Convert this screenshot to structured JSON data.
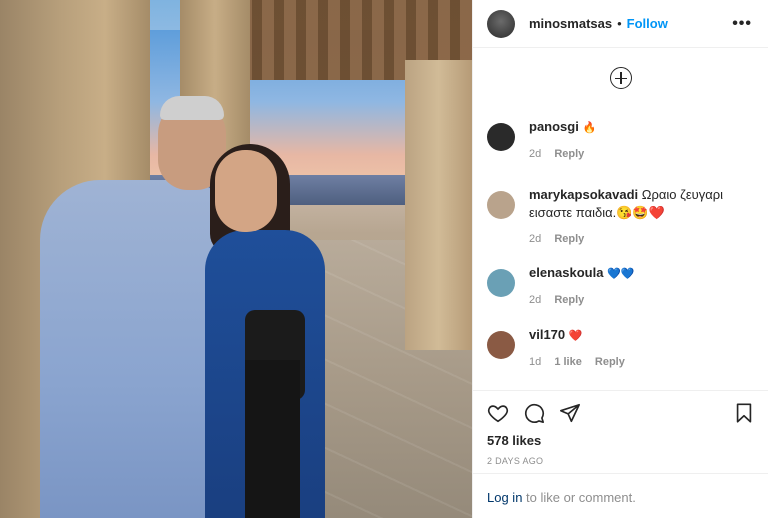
{
  "post": {
    "author": "minosmatsas",
    "separator": "•",
    "follow_label": "Follow",
    "more_label": "•••",
    "likes": "578 likes",
    "timestamp": "2 DAYS AGO"
  },
  "comments": [
    {
      "user": "panosgi",
      "text": "🔥",
      "time": "2d",
      "likes": "",
      "reply": "Reply",
      "avatar_color": "#2a2a2a"
    },
    {
      "user": "marykapsokavadi",
      "text": "Ωραιο ζευγαρι εισαστε παιδια.😘🤩❤️",
      "time": "2d",
      "likes": "",
      "reply": "Reply",
      "avatar_color": "#b9a38c"
    },
    {
      "user": "elenaskoula",
      "text": "💙💙",
      "time": "2d",
      "likes": "",
      "reply": "Reply",
      "avatar_color": "#6aa0b5"
    },
    {
      "user": "vil170",
      "text": "❤️",
      "time": "1d",
      "likes": "1 like",
      "reply": "Reply",
      "avatar_color": "#8a5a44"
    }
  ],
  "footer": {
    "login_link": "Log in",
    "login_suffix": "to like or comment."
  },
  "icons": {
    "add_comment": "plus-circle-icon",
    "like": "heart-icon",
    "comment": "comment-icon",
    "share": "paper-plane-icon",
    "save": "bookmark-icon"
  },
  "colors": {
    "follow": "#0095f6",
    "muted": "#8e8e8e",
    "link": "#00376b"
  }
}
